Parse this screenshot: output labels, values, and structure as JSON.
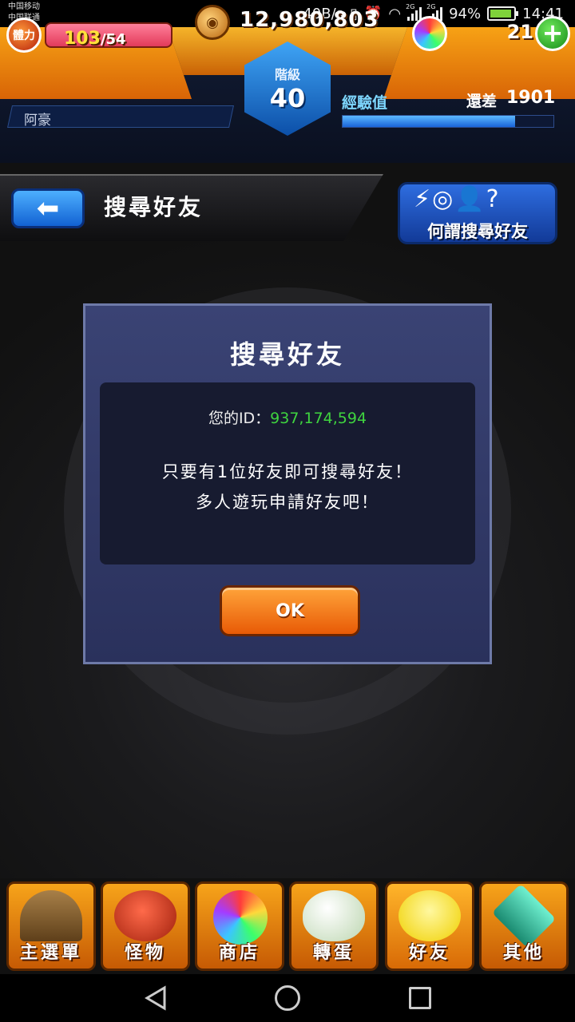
{
  "status_bar": {
    "carrier_1": "中国移动",
    "carrier_2": "中国联通",
    "net_speed": "40B/s",
    "network_1": "2G",
    "network_2": "2G",
    "battery": "94%",
    "time": "14:41"
  },
  "hud": {
    "stamina_label": "體力",
    "stamina_current": "103",
    "stamina_max": "/54",
    "coins": "12,980,803",
    "orbs": "21",
    "rank_label": "階級",
    "rank_value": "40",
    "player_name": "阿豪",
    "exp_label": "經驗值",
    "exp_remaining_label": "還差",
    "exp_remaining_value": "1901",
    "exp_fill_fraction": 0.82
  },
  "header": {
    "title": "搜尋好友",
    "help_label": "何謂搜尋好友",
    "help_icons": "⚡◎👤?"
  },
  "dialog": {
    "title": "搜尋好友",
    "id_label": "您的ID：",
    "id_value": "937,174,594",
    "message_line_1": "只要有1位好友即可搜尋好友！",
    "message_line_2": "多人遊玩申請好友吧！",
    "ok_label": "OK"
  },
  "bottom_nav": {
    "items": [
      {
        "label": "主選單",
        "icon": "gate-icon",
        "color": "#8a6a3a"
      },
      {
        "label": "怪物",
        "icon": "monster-icon",
        "color": "#d8402a"
      },
      {
        "label": "商店",
        "icon": "orb-icon",
        "color": "#7a5cff"
      },
      {
        "label": "轉蛋",
        "icon": "egg-icon",
        "color": "#e8efe0"
      },
      {
        "label": "好友",
        "icon": "friends-icon",
        "color": "#ffe63a"
      },
      {
        "label": "其他",
        "icon": "other-icon",
        "color": "#3ac8a8"
      }
    ]
  },
  "colors": {
    "accent_orange": "#f08a10",
    "id_green": "#3fd43f",
    "exp_blue": "#1a64d8"
  }
}
